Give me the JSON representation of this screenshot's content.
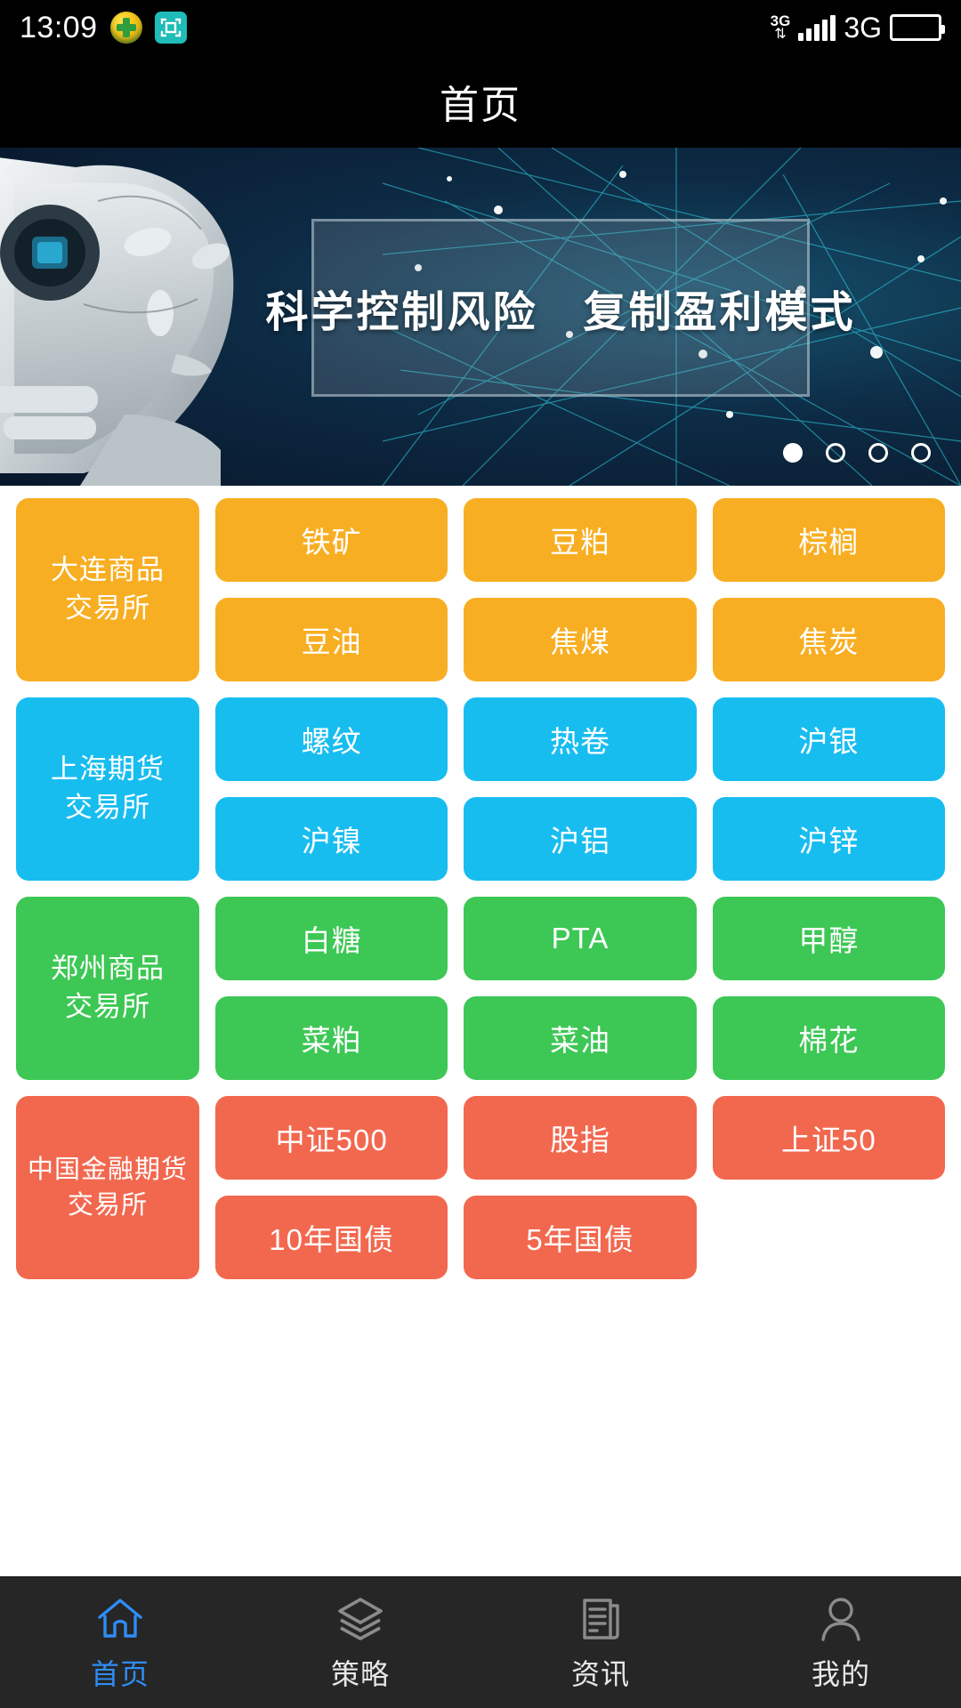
{
  "status_bar": {
    "time": "13:09",
    "plus_icon": "plus-badge-icon",
    "scan_icon": "scan-frame-icon",
    "data_3g_small": "3G",
    "data_arrows": "⇅",
    "network_label": "3G",
    "signal_icon": "signal-bars-icon",
    "battery_icon": "battery-icon"
  },
  "header": {
    "title": "首页"
  },
  "banner": {
    "caption": "科学控制风险　复制盈利模式",
    "image_alt": "robot-network-banner",
    "dots": [
      "1",
      "2",
      "3",
      "4"
    ],
    "active_dot_index": 0
  },
  "exchanges": [
    {
      "name": "大连商品\n交易所",
      "name_line1": "大连商品",
      "name_line2": "交易所",
      "color": "#F8AE22",
      "items": [
        "铁矿",
        "豆粕",
        "棕榈",
        "豆油",
        "焦煤",
        "焦炭"
      ]
    },
    {
      "name_line1": "上海期货",
      "name_line2": "交易所",
      "color": "#18BDF0",
      "items": [
        "螺纹",
        "热卷",
        "沪银",
        "沪镍",
        "沪铝",
        "沪锌"
      ]
    },
    {
      "name_line1": "郑州商品",
      "name_line2": "交易所",
      "color": "#3DC755",
      "items": [
        "白糖",
        "PTA",
        "甲醇",
        "菜粕",
        "菜油",
        "棉花"
      ]
    },
    {
      "name_line1": "中国金融期货",
      "name_line2": "交易所",
      "color": "#F2684F",
      "items": [
        "中证500",
        "股指",
        "上证50",
        "10年国债",
        "5年国债",
        ""
      ]
    }
  ],
  "tabbar": {
    "items": [
      {
        "label": "首页",
        "icon": "home-icon",
        "active": true
      },
      {
        "label": "策略",
        "icon": "layers-icon",
        "active": false
      },
      {
        "label": "资讯",
        "icon": "news-document-icon",
        "active": false
      },
      {
        "label": "我的",
        "icon": "person-icon",
        "active": false
      }
    ],
    "active_color": "#2F8DF5",
    "inactive_color": "#E8E8E8"
  }
}
